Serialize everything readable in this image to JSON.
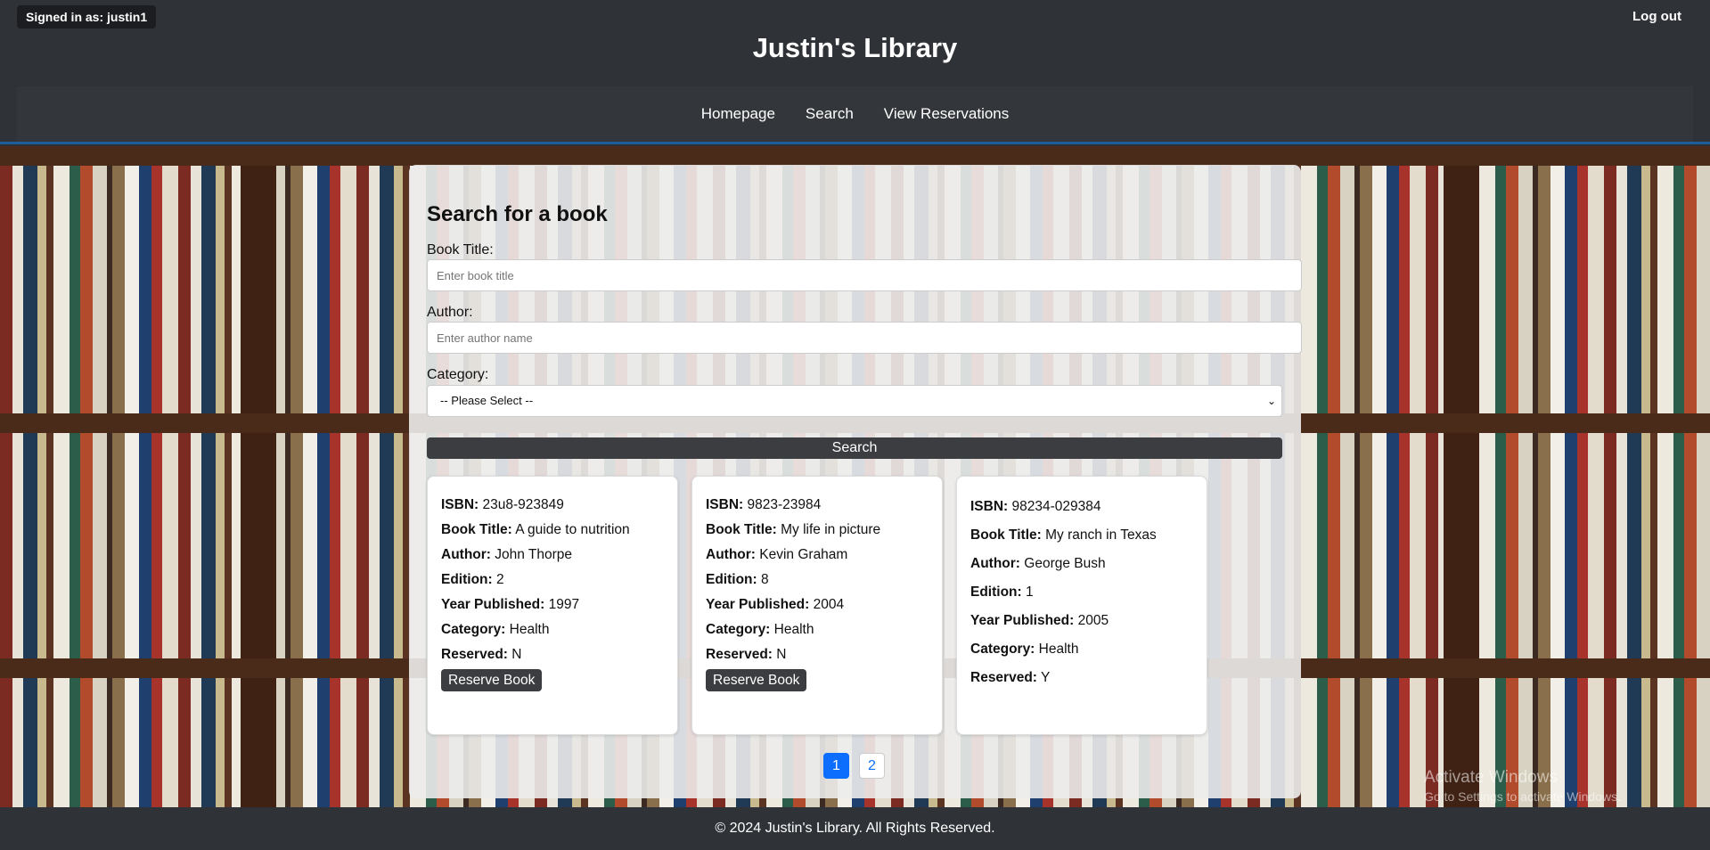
{
  "header": {
    "signed_in": "Signed in as: justin1",
    "logout": "Log out",
    "title": "Justin's Library",
    "nav": [
      "Homepage",
      "Search",
      "View Reservations"
    ]
  },
  "search": {
    "heading": "Search for a book",
    "title_label": "Book Title:",
    "title_placeholder": "Enter book title",
    "author_label": "Author:",
    "author_placeholder": "Enter author name",
    "category_label": "Category:",
    "category_selected": "-- Please Select --",
    "button": "Search"
  },
  "labels": {
    "isbn": "ISBN:",
    "title": "Book Title:",
    "author": "Author:",
    "edition": "Edition:",
    "year": "Year Published:",
    "category": "Category:",
    "reserved": "Reserved:",
    "reserve_button": "Reserve Book"
  },
  "books": [
    {
      "isbn": "23u8-923849",
      "title": "A guide to nutrition",
      "author": "John Thorpe",
      "edition": "2",
      "year": "1997",
      "category": "Health",
      "reserved": "N"
    },
    {
      "isbn": "9823-23984",
      "title": "My life in picture",
      "author": "Kevin Graham",
      "edition": "8",
      "year": "2004",
      "category": "Health",
      "reserved": "N"
    },
    {
      "isbn": "98234-029384",
      "title": "My ranch in Texas",
      "author": "George Bush",
      "edition": "1",
      "year": "2005",
      "category": "Health",
      "reserved": "Y"
    }
  ],
  "pagination": [
    "1",
    "2"
  ],
  "footer": "© 2024 Justin's Library. All Rights Reserved.",
  "watermark": {
    "title": "Activate Windows",
    "sub": "Go to Settings to activate Windows."
  }
}
